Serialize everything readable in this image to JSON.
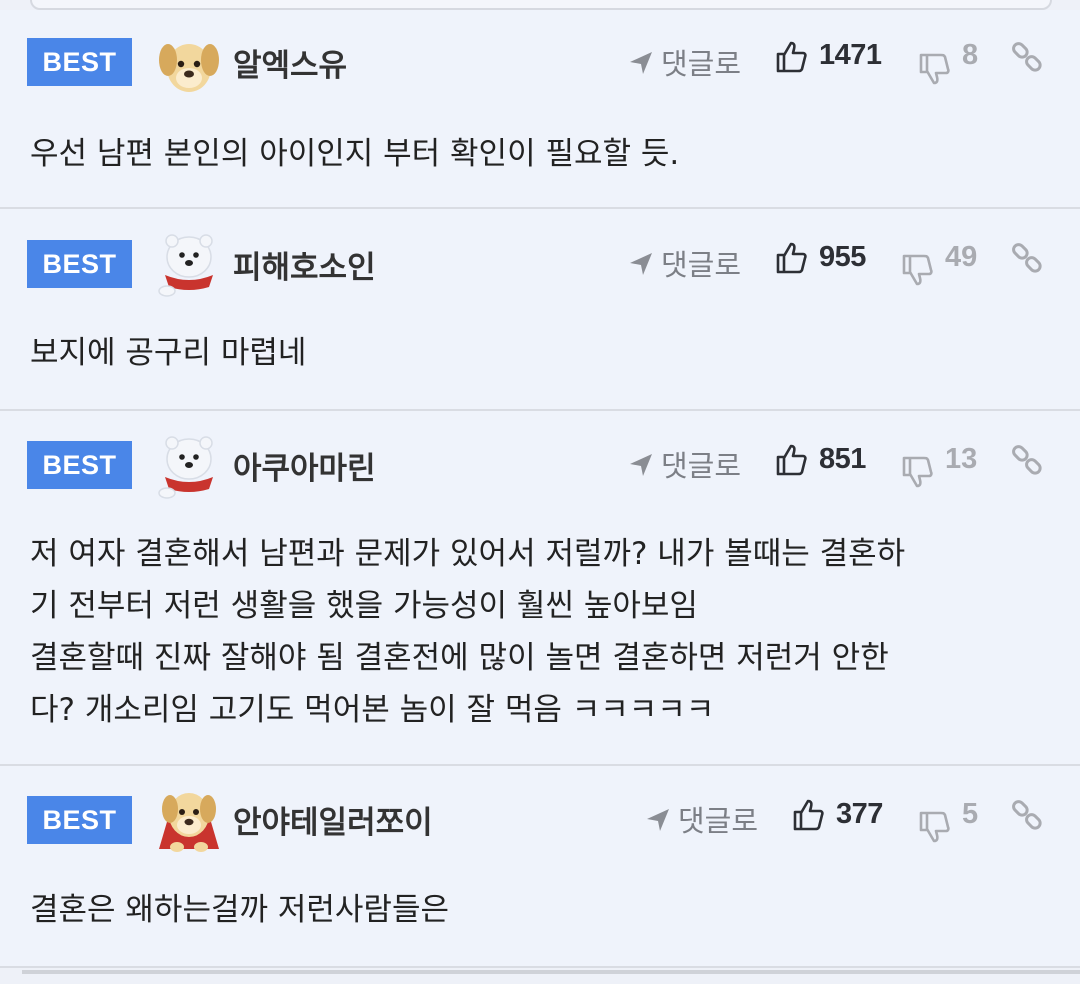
{
  "comments": [
    {
      "badge": "BEST",
      "nickname": "알엑스유",
      "reply_label": "댓글로",
      "upvotes": "1471",
      "downvotes": "8",
      "avatar": "puppy-avatar",
      "lines": [
        "우선 남편 본인의 아이인지 부터 확인이 필요할 듯."
      ]
    },
    {
      "badge": "BEST",
      "nickname": "피해호소인",
      "reply_label": "댓글로",
      "upvotes": "955",
      "downvotes": "49",
      "avatar": "polar-bear-avatar",
      "lines": [
        "보지에 공구리 마렵네"
      ]
    },
    {
      "badge": "BEST",
      "nickname": "아쿠아마린",
      "reply_label": "댓글로",
      "upvotes": "851",
      "downvotes": "13",
      "avatar": "polar-bear-avatar",
      "lines": [
        "저 여자 결혼해서 남편과 문제가 있어서 저럴까? 내가 볼때는 결혼하",
        "기 전부터 저런 생활을 했을 가능성이 훨씬 높아보임",
        "결혼할때 진짜 잘해야 됨 결혼전에 많이 놀면 결혼하면 저런거 안한",
        "다? 개소리임 고기도 먹어본 놈이 잘 먹음 ㅋㅋㅋㅋㅋ"
      ]
    },
    {
      "badge": "BEST",
      "nickname": "안야테일러쪼이",
      "reply_label": "댓글로",
      "upvotes": "377",
      "downvotes": "5",
      "avatar": "puppy-cape-avatar",
      "lines": [
        "결혼은 왜하는걸까 저런사람들은"
      ]
    }
  ],
  "colors": {
    "badge": "#4a86e8",
    "background": "#eff3fb",
    "icon": "#555a63",
    "muted": "#a9abb1"
  }
}
